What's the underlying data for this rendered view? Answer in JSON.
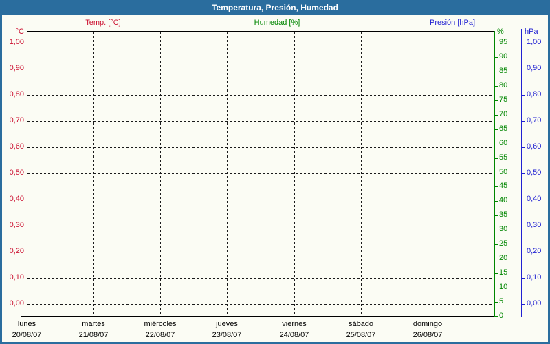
{
  "window": {
    "title": "Temperatura, Presión, Humedad"
  },
  "colors": {
    "frame": "#2a6d9e",
    "background": "#fbfcf4",
    "temp": "#cc1232",
    "humidity": "#008600",
    "pressure": "#2121d2"
  },
  "legend": {
    "temp": "Temp. [°C]",
    "humidity": "Humedad [%]",
    "pressure": "Presión [hPa]"
  },
  "axis_temp": {
    "unit": "°C",
    "ticks": [
      "1,00",
      "0,90",
      "0,80",
      "0,70",
      "0,60",
      "0,50",
      "0,40",
      "0,30",
      "0,20",
      "0,10",
      "0,00"
    ]
  },
  "axis_humidity": {
    "unit": "%",
    "ticks": [
      "95",
      "90",
      "85",
      "80",
      "75",
      "70",
      "65",
      "60",
      "55",
      "50",
      "45",
      "40",
      "35",
      "30",
      "25",
      "20",
      "15",
      "10",
      "5",
      "0"
    ]
  },
  "axis_pressure": {
    "unit": "hPa",
    "ticks": [
      "1,00",
      "0,90",
      "0,80",
      "0,70",
      "0,60",
      "0,50",
      "0,40",
      "0,30",
      "0,20",
      "0,10",
      "0,00"
    ]
  },
  "x_axis": {
    "days": [
      {
        "name": "lunes",
        "date": "20/08/07"
      },
      {
        "name": "martes",
        "date": "21/08/07"
      },
      {
        "name": "miércoles",
        "date": "22/08/07"
      },
      {
        "name": "jueves",
        "date": "23/08/07"
      },
      {
        "name": "viernes",
        "date": "24/08/07"
      },
      {
        "name": "sábado",
        "date": "25/08/07"
      },
      {
        "name": "domingo",
        "date": "26/08/07"
      }
    ]
  },
  "chart_data": {
    "type": "line",
    "title": "Temperatura, Presión, Humedad",
    "x_categories": [
      "lunes 20/08/07",
      "martes 21/08/07",
      "miércoles 22/08/07",
      "jueves 23/08/07",
      "viernes 24/08/07",
      "sábado 25/08/07",
      "domingo 26/08/07"
    ],
    "series": [
      {
        "name": "Temp. [°C]",
        "color": "#cc1232",
        "axis": "left",
        "range": [
          0.0,
          1.0
        ],
        "tick_step": 0.1,
        "values": []
      },
      {
        "name": "Humedad [%]",
        "color": "#008600",
        "axis": "right-inner",
        "range": [
          0,
          100
        ],
        "tick_step": 5,
        "values": []
      },
      {
        "name": "Presión [hPa]",
        "color": "#2121d2",
        "axis": "right-outer",
        "range": [
          0.0,
          1.0
        ],
        "tick_step": 0.1,
        "values": []
      }
    ],
    "grid": "dashed",
    "legend_position": "top",
    "empty": true
  }
}
